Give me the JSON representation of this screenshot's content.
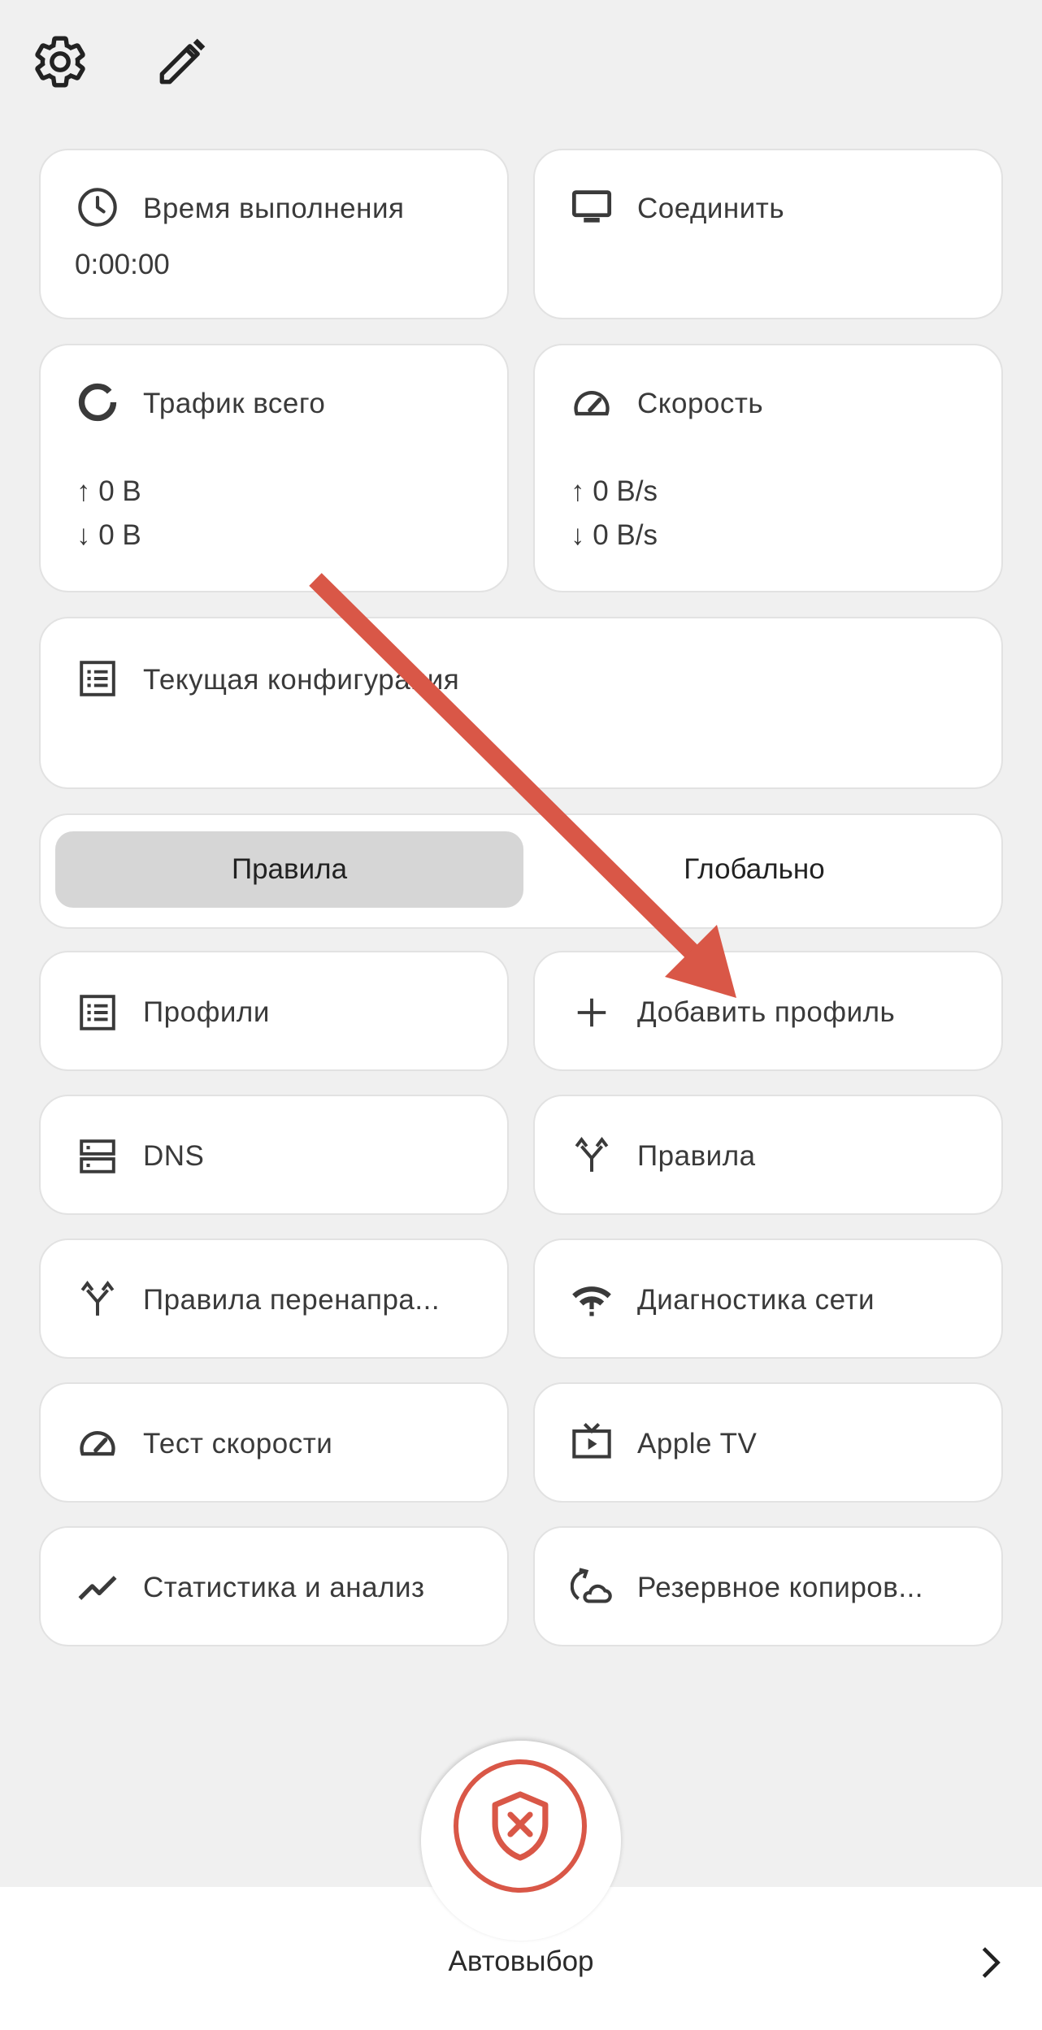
{
  "toolbar": {
    "settings_icon": "gear-icon",
    "edit_icon": "pencil-icon"
  },
  "cards": {
    "runtime": {
      "label": "Время выполнения",
      "value": "0:00:00",
      "icon": "clock-icon"
    },
    "connect": {
      "label": "Соединить",
      "icon": "monitor-icon"
    },
    "traffic": {
      "label": "Трафик всего",
      "up": "↑ 0 B",
      "down": "↓ 0 B",
      "icon": "ring-icon"
    },
    "speed": {
      "label": "Скорость",
      "up": "↑ 0 B/s",
      "down": "↓ 0 B/s",
      "icon": "speedometer-icon"
    },
    "config": {
      "label": "Текущая конфигурация",
      "icon": "list-icon"
    }
  },
  "mode": {
    "options": [
      "Правила",
      "Глобально"
    ],
    "selected": "Правила"
  },
  "menu": [
    {
      "label": "Профили",
      "icon": "list-icon"
    },
    {
      "label": "Добавить профиль",
      "icon": "plus-icon"
    },
    {
      "label": "DNS",
      "icon": "server-icon"
    },
    {
      "label": "Правила",
      "icon": "fork-icon"
    },
    {
      "label": "Правила перенапра...",
      "icon": "fork-icon"
    },
    {
      "label": "Диагностика сети",
      "icon": "wifi-alert-icon"
    },
    {
      "label": "Тест скорости",
      "icon": "speedometer-icon"
    },
    {
      "label": "Apple TV",
      "icon": "tv-icon"
    },
    {
      "label": "Статистика и анализ",
      "icon": "trend-icon"
    },
    {
      "label": "Резервное копиров...",
      "icon": "backup-icon"
    }
  ],
  "bottom": {
    "connect_button_icon": "shield-x-icon",
    "selector_label": "Автовыбор",
    "chevron_icon": "chevron-right-icon"
  },
  "colors": {
    "accent": "#d95747",
    "background": "#f0f0f0",
    "card": "#ffffff",
    "selected_segment": "#d6d6d6"
  }
}
